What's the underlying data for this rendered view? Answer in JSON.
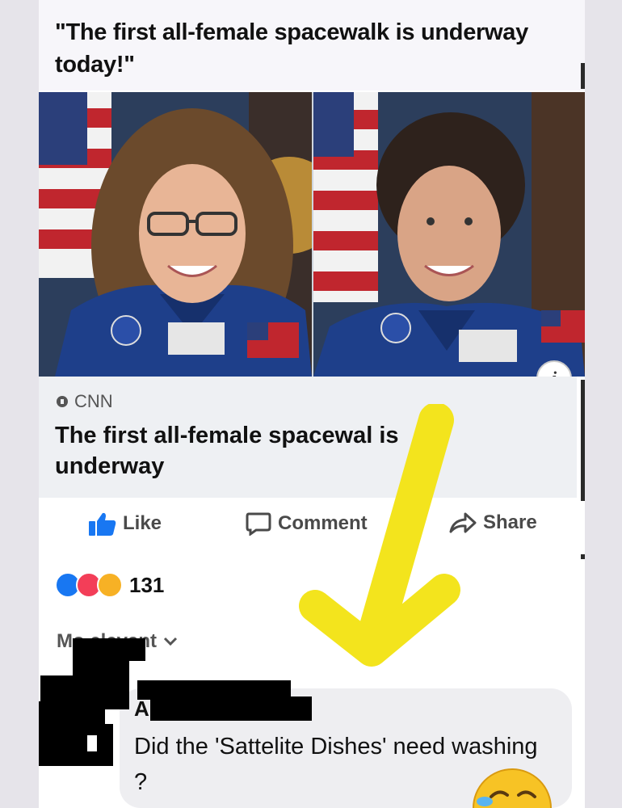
{
  "post": {
    "text": "\"The first all-female spacewalk is underway today!\""
  },
  "link_card": {
    "source": "CNN",
    "headline": "The first all-female spacewal  is underway",
    "info_icon": "info-icon",
    "info_glyph": "i"
  },
  "actions": {
    "like_label": "Like",
    "comment_label": "Comment",
    "share_label": "Share"
  },
  "reactions": {
    "icons": [
      "like-reaction-icon",
      "love-reaction-icon",
      "haha-reaction-icon"
    ],
    "count": "131"
  },
  "comments": {
    "sort_label": "Mo  elevant",
    "items": [
      {
        "author": "A",
        "text": "Did the 'Sattelite Dishes' need washing ?"
      }
    ]
  },
  "colors": {
    "accent_blue": "#1877f2",
    "annotation_yellow": "#f3e41d",
    "text_dark": "#111111",
    "text_muted": "#4a4a4a"
  }
}
